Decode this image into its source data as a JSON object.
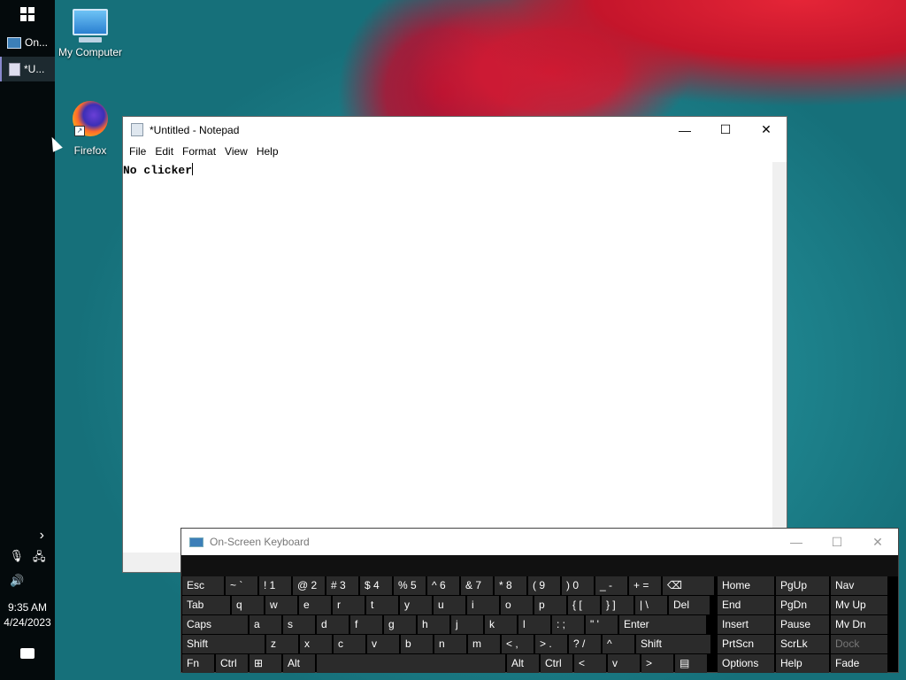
{
  "taskbar": {
    "apps": [
      {
        "label": "On...",
        "icon": "keyboard-icon"
      },
      {
        "label": "*U...",
        "icon": "notepad-icon"
      }
    ],
    "tray": {
      "expand": "›",
      "time": "9:35 AM",
      "date": "4/24/2023"
    }
  },
  "desktop": {
    "icons": [
      {
        "label": "My Computer",
        "icon": "computer-icon"
      },
      {
        "label": "Firefox",
        "icon": "firefox-icon"
      }
    ]
  },
  "notepad": {
    "title": "*Untitled - Notepad",
    "menu": [
      "File",
      "Edit",
      "Format",
      "View",
      "Help"
    ],
    "content": "No clicker",
    "controls": {
      "minimize": "—",
      "maximize": "☐",
      "close": "✕"
    }
  },
  "osk": {
    "title": "On-Screen Keyboard",
    "controls": {
      "minimize": "—",
      "maximize": "☐",
      "close": "✕"
    },
    "rows": [
      [
        "Esc",
        "~ `",
        "! 1",
        "@ 2",
        "# 3",
        "$ 4",
        "% 5",
        "^ 6",
        "& 7",
        "* 8",
        "( 9",
        ") 0",
        "_ -",
        "+ =",
        "⌫",
        "Home",
        "PgUp",
        "Nav"
      ],
      [
        "Tab",
        "q",
        "w",
        "e",
        "r",
        "t",
        "y",
        "u",
        "i",
        "o",
        "p",
        "{ [",
        "} ]",
        "| \\",
        "Del",
        "End",
        "PgDn",
        "Mv Up"
      ],
      [
        "Caps",
        "a",
        "s",
        "d",
        "f",
        "g",
        "h",
        "j",
        "k",
        "l",
        ": ;",
        "\" '",
        "Enter",
        "Insert",
        "Pause",
        "Mv Dn"
      ],
      [
        "Shift",
        "z",
        "x",
        "c",
        "v",
        "b",
        "n",
        "m",
        "< ,",
        "> .",
        "? /",
        "^",
        "Shift",
        "PrtScn",
        "ScrLk",
        "Dock"
      ],
      [
        "Fn",
        "Ctrl",
        "⊞",
        "Alt",
        "",
        "Alt",
        "Ctrl",
        "<",
        "v",
        ">",
        "▤",
        "Options",
        "Help",
        "Fade"
      ]
    ]
  }
}
